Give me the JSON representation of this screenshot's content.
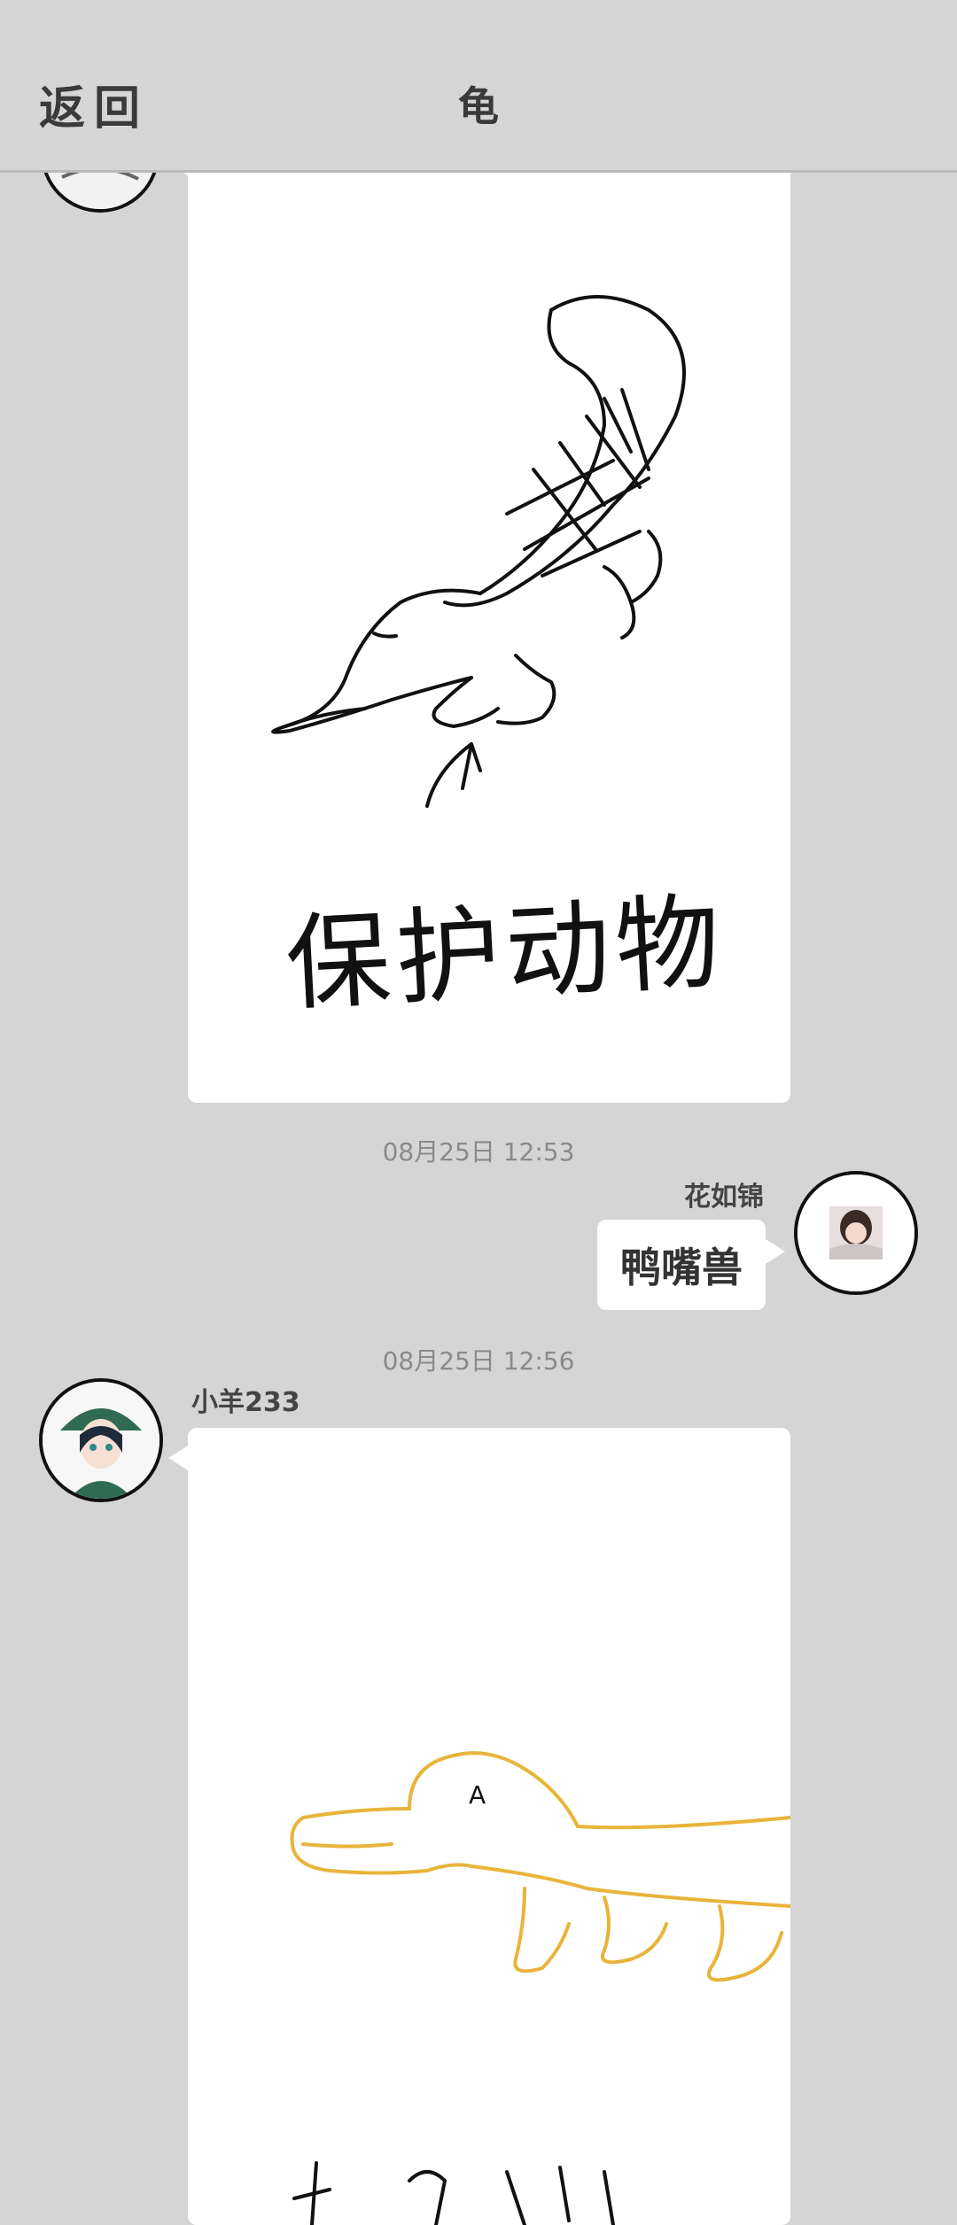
{
  "header": {
    "back_label": "返回",
    "title": "龟"
  },
  "messages": [
    {
      "sender": "other",
      "type": "drawing",
      "drawing_text": "保护动物",
      "ink_color": "#111111"
    },
    {
      "timestamp": "08月25日  12:53",
      "sender": "self",
      "name": "花如锦",
      "type": "text",
      "text": "鸭嘴兽"
    },
    {
      "timestamp": "08月25日  12:56",
      "sender": "other",
      "name": "小羊233",
      "type": "drawing",
      "ink_color": "#e8b43a"
    }
  ]
}
